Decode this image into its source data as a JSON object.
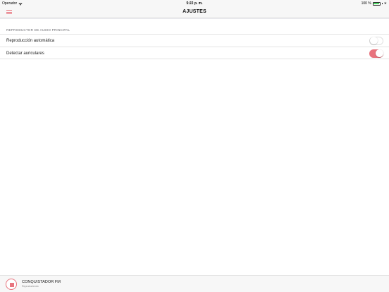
{
  "statusbar": {
    "carrier": "Operador",
    "time": "5:22 p. m.",
    "battery_text": "100 %",
    "battery_level": 1.0,
    "icons": [
      "wifi-icon",
      "battery-icon",
      "bluetooth-icon"
    ]
  },
  "navbar": {
    "title": "AJUSTES",
    "menu_icon": "menu-icon"
  },
  "section": {
    "header": "REPRODUCTOR DE AUDIO PRINCIPAL",
    "rows": [
      {
        "label": "Reproducción automática",
        "toggle": false
      },
      {
        "label": "Detectar auriculares",
        "toggle": true
      }
    ]
  },
  "player": {
    "station": "CONQUISTADOR FM",
    "status": "Reproduciendo",
    "control_icon": "stop-icon"
  },
  "colors": {
    "accent": "#e8737d",
    "battery": "#4cd964"
  }
}
